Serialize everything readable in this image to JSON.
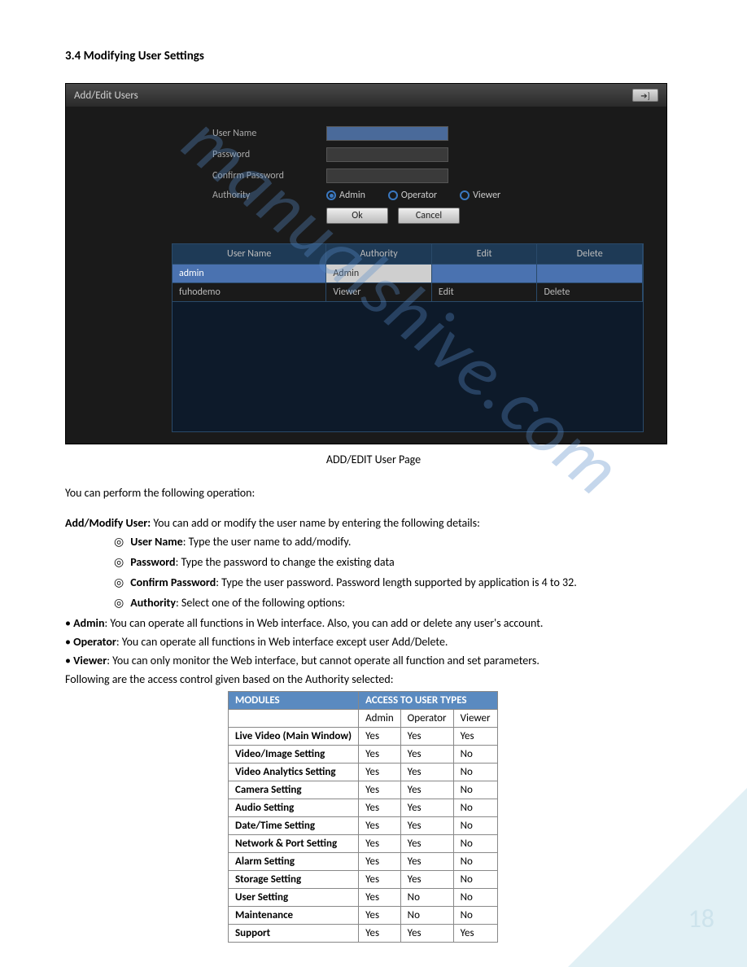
{
  "section": {
    "number": "3.4",
    "title": "Modifying User Settings"
  },
  "app": {
    "title": "Add/Edit Users",
    "fields": {
      "username_label": "User Name",
      "password_label": "Password",
      "confirm_label": "Confirm Password",
      "authority_label": "Authority"
    },
    "radios": {
      "admin": "Admin",
      "operator": "Operator",
      "viewer": "Viewer"
    },
    "buttons": {
      "ok": "Ok",
      "cancel": "Cancel"
    },
    "grid": {
      "headers": {
        "c1": "User Name",
        "c2": "Authority",
        "c3": "Edit",
        "c4": "Delete"
      },
      "rows": [
        {
          "user": "admin",
          "auth": "Admin",
          "edit": "",
          "del": ""
        },
        {
          "user": "fuhodemo",
          "auth": "Viewer",
          "edit": "Edit",
          "del": "Delete"
        }
      ]
    }
  },
  "caption": "ADD/EDIT User Page",
  "intro": "You can perform the following operation:",
  "addmod": {
    "lead_b": "Add/Modify User:",
    "lead": " You can add or modify the user name by entering the following details:",
    "items": [
      {
        "b": "User Name",
        "t": ": Type the user name to add/modify."
      },
      {
        "b": "Password",
        "t": ": Type the password to change the existing data"
      },
      {
        "b": "Confirm Password",
        "t": ": Type the user password. Password length supported by application is 4 to 32."
      },
      {
        "b": "Authority",
        "t": ": Select one of the following options:"
      }
    ]
  },
  "roles": [
    {
      "b": "Admin",
      "t": ": You can operate all functions in Web interface. Also, you can add or delete any user's account."
    },
    {
      "b": "Operator",
      "t": ": You can operate all functions in Web interface except user Add/Delete."
    },
    {
      "b": "Viewer",
      "t": ": You can only monitor the Web interface, but cannot operate all function and set parameters."
    }
  ],
  "access_intro": "Following are the access control given based on the Authority selected:",
  "access_table": {
    "h1": "MODULES",
    "h2": "ACCESS TO USER TYPES",
    "sub": {
      "c1": "Admin",
      "c2": "Operator",
      "c3": "Viewer"
    },
    "rows": [
      {
        "m": "Live Video (Main Window)",
        "a": "Yes",
        "o": "Yes",
        "v": "Yes"
      },
      {
        "m": "Video/Image Setting",
        "a": "Yes",
        "o": "Yes",
        "v": "No"
      },
      {
        "m": "Video Analytics Setting",
        "a": "Yes",
        "o": "Yes",
        "v": "No"
      },
      {
        "m": "Camera Setting",
        "a": "Yes",
        "o": "Yes",
        "v": "No"
      },
      {
        "m": "Audio Setting",
        "a": "Yes",
        "o": "Yes",
        "v": "No"
      },
      {
        "m": "Date/Time Setting",
        "a": "Yes",
        "o": "Yes",
        "v": "No"
      },
      {
        "m": "Network & Port Setting",
        "a": "Yes",
        "o": "Yes",
        "v": "No"
      },
      {
        "m": "Alarm Setting",
        "a": "Yes",
        "o": "Yes",
        "v": "No"
      },
      {
        "m": "Storage Setting",
        "a": "Yes",
        "o": "Yes",
        "v": "No"
      },
      {
        "m": "User Setting",
        "a": "Yes",
        "o": "No",
        "v": "No"
      },
      {
        "m": "Maintenance",
        "a": "Yes",
        "o": "No",
        "v": "No"
      },
      {
        "m": "Support",
        "a": "Yes",
        "o": "Yes",
        "v": "Yes"
      }
    ]
  },
  "page_number": "18",
  "watermark": "manualshive.com"
}
